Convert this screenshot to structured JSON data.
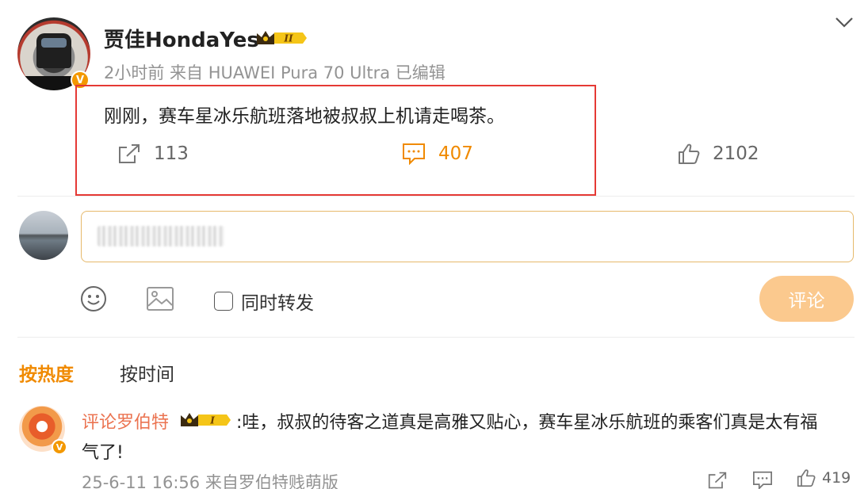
{
  "post": {
    "username": "贾佳HondaYes",
    "vip_level": "II",
    "verified_badge": "V",
    "meta": "2小时前 来自 HUAWEI Pura 70 Ultra 已编辑",
    "text": "刚刚，赛车星冰乐航班落地被叔叔上机请走喝茶。",
    "forward_count": "113",
    "comment_count": "407",
    "like_count": "2102"
  },
  "composer": {
    "repost_label": "同时转发",
    "submit_label": "评论"
  },
  "sort": {
    "hot_label": "按热度",
    "time_label": "按时间"
  },
  "comment": {
    "username": "评论罗伯特",
    "vip_level": "I",
    "verified_badge": "V",
    "text_line1": ":哇，叔叔的待客之道真是高雅又贴心，赛车星冰乐航班的乘客们真是太有福",
    "text_line2": "气了!",
    "meta": "25-6-11 16:56 来自罗伯特贱萌版",
    "like_count": "419"
  },
  "colors": {
    "accent": "#f08a00",
    "highlight_border": "#e53935",
    "submit_button": "#fbc98e",
    "comment_username": "#eb7350"
  },
  "icons": [
    "chevron-down-icon",
    "forward-icon",
    "comment-icon",
    "like-icon",
    "emoji-icon",
    "image-icon",
    "crown-badge-icon"
  ]
}
